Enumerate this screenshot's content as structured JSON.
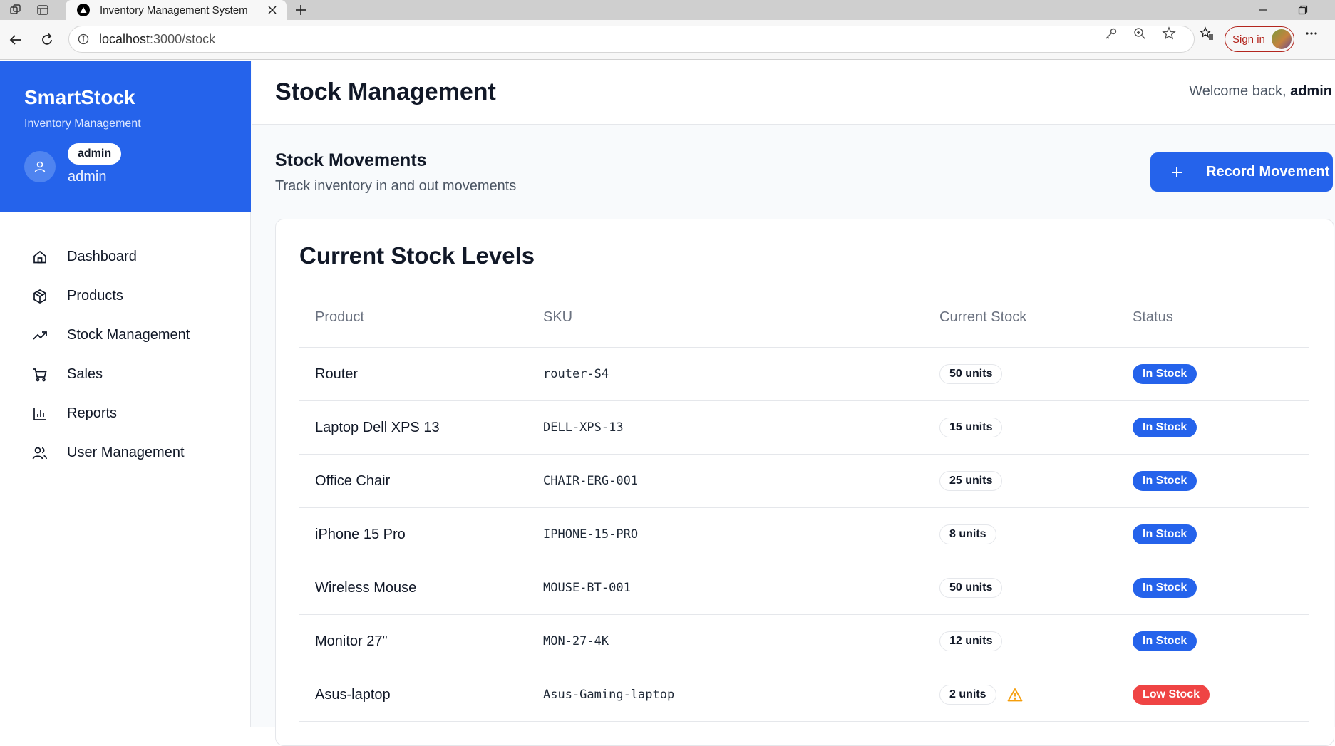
{
  "browser": {
    "tab_title": "Inventory Management System",
    "url_host": "localhost",
    "url_path": ":3000/stock",
    "signin_label": "Sign in"
  },
  "sidebar": {
    "brand_name": "SmartStock",
    "brand_subtitle": "Inventory Management",
    "user_role": "admin",
    "user_name": "admin",
    "items": [
      {
        "label": "Dashboard",
        "icon": "home-icon"
      },
      {
        "label": "Products",
        "icon": "box-icon"
      },
      {
        "label": "Stock Management",
        "icon": "trending-up-icon"
      },
      {
        "label": "Sales",
        "icon": "cart-icon"
      },
      {
        "label": "Reports",
        "icon": "bar-chart-icon"
      },
      {
        "label": "User Management",
        "icon": "users-icon"
      }
    ]
  },
  "header": {
    "title": "Stock Management",
    "welcome_prefix": "Welcome back, ",
    "welcome_user": "admin"
  },
  "section": {
    "title": "Stock Movements",
    "subtitle": "Track inventory in and out movements",
    "record_button": "Record Movement"
  },
  "stock_table": {
    "title": "Current Stock Levels",
    "columns": [
      "Product",
      "SKU",
      "Current Stock",
      "Status"
    ],
    "rows": [
      {
        "product": "Router",
        "sku": "router-S4",
        "stock": "50 units",
        "status": "In Stock",
        "low": false
      },
      {
        "product": "Laptop Dell XPS 13",
        "sku": "DELL-XPS-13",
        "stock": "15 units",
        "status": "In Stock",
        "low": false
      },
      {
        "product": "Office Chair",
        "sku": "CHAIR-ERG-001",
        "stock": "25 units",
        "status": "In Stock",
        "low": false
      },
      {
        "product": "iPhone 15 Pro",
        "sku": "IPHONE-15-PRO",
        "stock": "8 units",
        "status": "In Stock",
        "low": false
      },
      {
        "product": "Wireless Mouse",
        "sku": "MOUSE-BT-001",
        "stock": "50 units",
        "status": "In Stock",
        "low": false
      },
      {
        "product": "Monitor 27\"",
        "sku": "MON-27-4K",
        "stock": "12 units",
        "status": "In Stock",
        "low": false
      },
      {
        "product": "Asus-laptop",
        "sku": "Asus-Gaming-laptop",
        "stock": "2 units",
        "status": "Low Stock",
        "low": true
      }
    ]
  },
  "colors": {
    "primary": "#2563eb",
    "danger": "#ef4444",
    "warning": "#f59e0b"
  }
}
